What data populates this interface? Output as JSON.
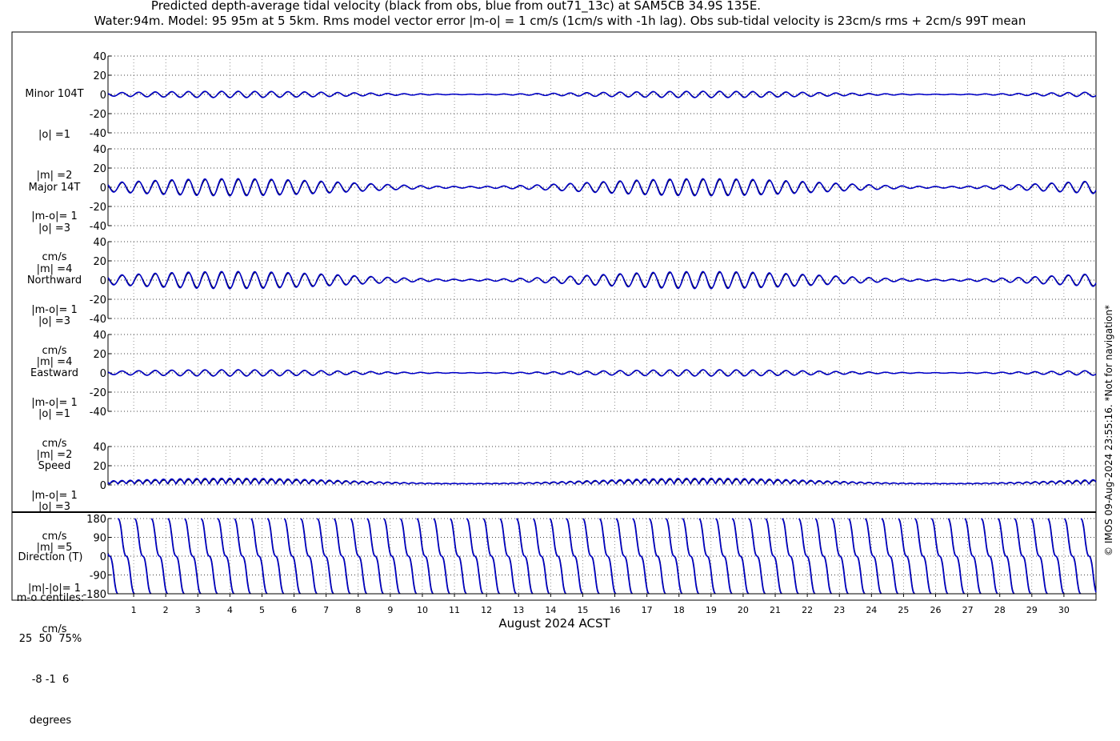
{
  "header": {
    "title_line1": "Predicted depth-average tidal velocity (black from obs, blue from out71_13c) at SAM5CB 34.9S 135E.",
    "title_line2": "Water:94m. Model: 95 95m at 5 5km. Rms model vector error |m-o| = 1 cm/s (1cm/s with -1h lag). Obs sub-tidal velocity is 23cm/s rms + 2cm/s 99T mean"
  },
  "copyright": "© IMOS 09-Aug-2024 23:55:16. *Not for navigation*",
  "chart_data": {
    "type": "line",
    "xlabel": "August 2024 ACST",
    "x_ticks": [
      "1",
      "2",
      "3",
      "4",
      "5",
      "6",
      "7",
      "8",
      "9",
      "10",
      "11",
      "12",
      "13",
      "14",
      "15",
      "16",
      "17",
      "18",
      "19",
      "20",
      "21",
      "22",
      "23",
      "24",
      "25",
      "26",
      "27",
      "28",
      "29",
      "30"
    ],
    "xlim_days": [
      0.2,
      31
    ],
    "grid": true,
    "series_colors": {
      "obs": "#000000",
      "model": "#0000cc"
    },
    "panels": [
      {
        "key": "minor",
        "label_lines": [
          "Minor 104T",
          "|o| =1",
          "|m| =2",
          "|m-o|= 1",
          "cm/s"
        ],
        "ylim": [
          -40,
          40
        ],
        "yticks": [
          "40",
          "20",
          "0",
          "-20",
          "-40"
        ],
        "amplitude": 3
      },
      {
        "key": "major",
        "label_lines": [
          "Major 14T",
          "|o| =3",
          "|m| =4",
          "|m-o|= 1",
          "cm/s"
        ],
        "ylim": [
          -40,
          40
        ],
        "yticks": [
          "40",
          "20",
          "0",
          "-20",
          "-40"
        ],
        "amplitude": 8
      },
      {
        "key": "north",
        "label_lines": [
          "Northward",
          "|o| =3",
          "|m| =4",
          "|m-o|= 1",
          "cm/s"
        ],
        "ylim": [
          -40,
          40
        ],
        "yticks": [
          "40",
          "20",
          "0",
          "-20",
          "-40"
        ],
        "amplitude": 8
      },
      {
        "key": "east",
        "label_lines": [
          "Eastward",
          "|o| =1",
          "|m| =2",
          "|m-o|= 1",
          "cm/s"
        ],
        "ylim": [
          -40,
          40
        ],
        "yticks": [
          "40",
          "20",
          "0",
          "-20",
          "-40"
        ],
        "amplitude": 3
      },
      {
        "key": "speed",
        "label_lines": [
          "Speed",
          "|o| =3",
          "|m| =5",
          "|m|-|o|= 1",
          "cm/s"
        ],
        "ylim": [
          0,
          40
        ],
        "yticks": [
          "40",
          "20",
          "0"
        ],
        "amplitude": 8
      },
      {
        "key": "direction",
        "label_lines": [
          "Direction (T)",
          "m-o centiles:",
          "25  50  75%",
          "-8 -1  6",
          "degrees"
        ],
        "ylim": [
          -180,
          180
        ],
        "yticks": [
          "180",
          "90",
          "0",
          "-90",
          "-180"
        ]
      }
    ]
  }
}
